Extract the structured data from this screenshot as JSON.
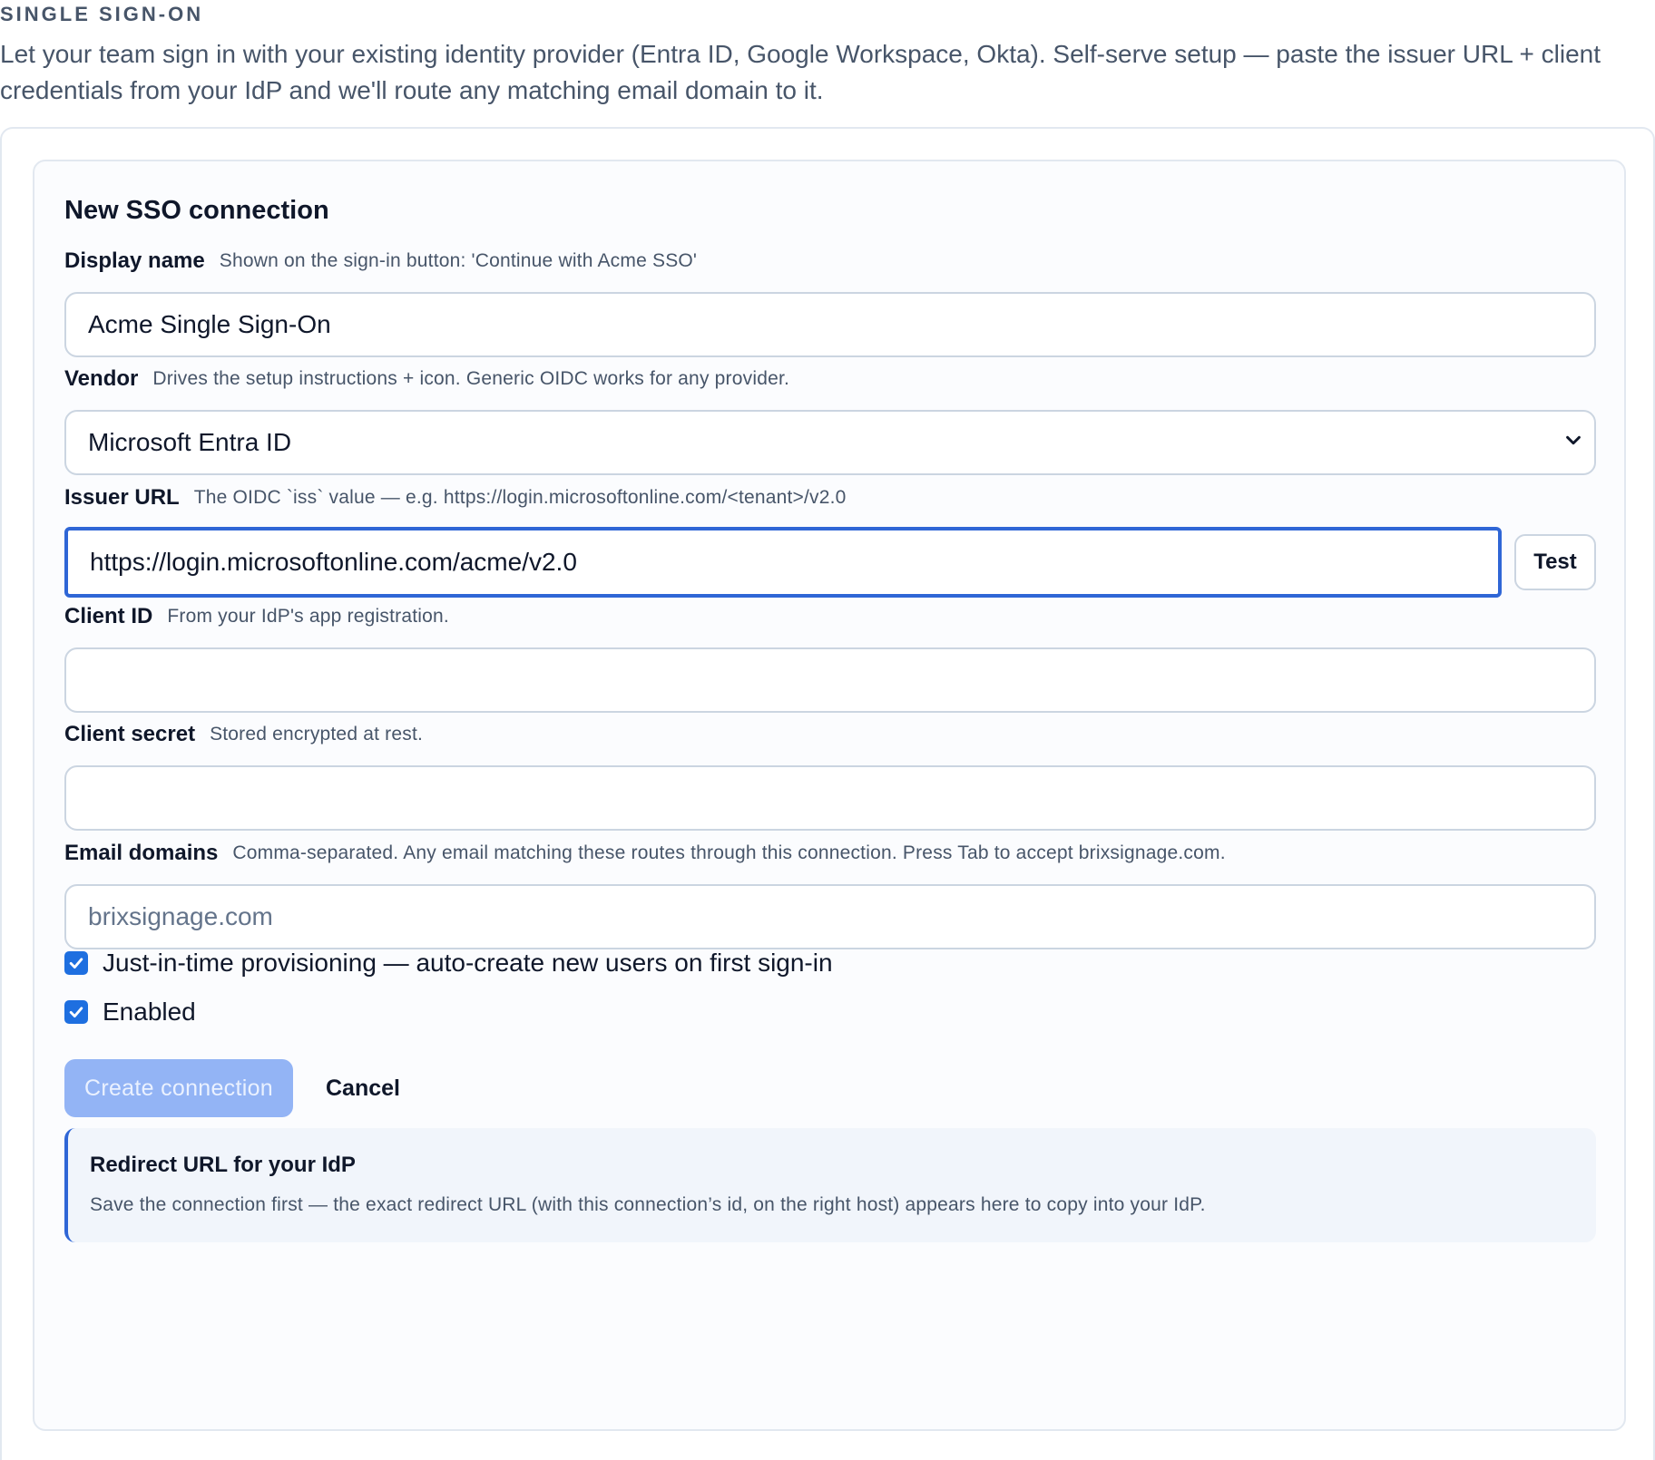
{
  "section": {
    "label": "SINGLE SIGN-ON",
    "intro": "Let your team sign in with your existing identity provider (Entra ID, Google Workspace, Okta). Self-serve setup — paste the issuer URL + client credentials from your IdP and we'll route any matching email domain to it."
  },
  "form": {
    "title": "New SSO connection",
    "display_name": {
      "label": "Display name",
      "hint": "Shown on the sign-in button: 'Continue with Acme SSO'",
      "value": "Acme Single Sign-On"
    },
    "vendor": {
      "label": "Vendor",
      "hint": "Drives the setup instructions + icon. Generic OIDC works for any provider.",
      "selected": "Microsoft Entra ID"
    },
    "issuer_url": {
      "label": "Issuer URL",
      "hint": "The OIDC `iss` value — e.g. https://login.microsoftonline.com/<tenant>/v2.0",
      "value": "https://login.microsoftonline.com/acme/v2.0",
      "test_label": "Test"
    },
    "client_id": {
      "label": "Client ID",
      "hint": "From your IdP's app registration.",
      "value": ""
    },
    "client_secret": {
      "label": "Client secret",
      "hint": "Stored encrypted at rest.",
      "value": ""
    },
    "email_domains": {
      "label": "Email domains",
      "hint": "Comma-separated. Any email matching these routes through this connection. Press Tab to accept brixsignage.com.",
      "placeholder": "brixsignage.com",
      "value": ""
    },
    "jit": {
      "label": "Just-in-time provisioning — auto-create new users on first sign-in",
      "checked": true
    },
    "enabled": {
      "label": "Enabled",
      "checked": true
    },
    "actions": {
      "create_label": "Create connection",
      "cancel_label": "Cancel"
    },
    "redirect_info": {
      "title": "Redirect URL for your IdP",
      "text": "Save the connection first — the exact redirect URL (with this connection’s id, on the right host) appears here to copy into your IdP."
    }
  },
  "colors": {
    "accent": "#2f66d6",
    "checkbox": "#1e6fe0",
    "disabled_button": "#93b4f5"
  }
}
